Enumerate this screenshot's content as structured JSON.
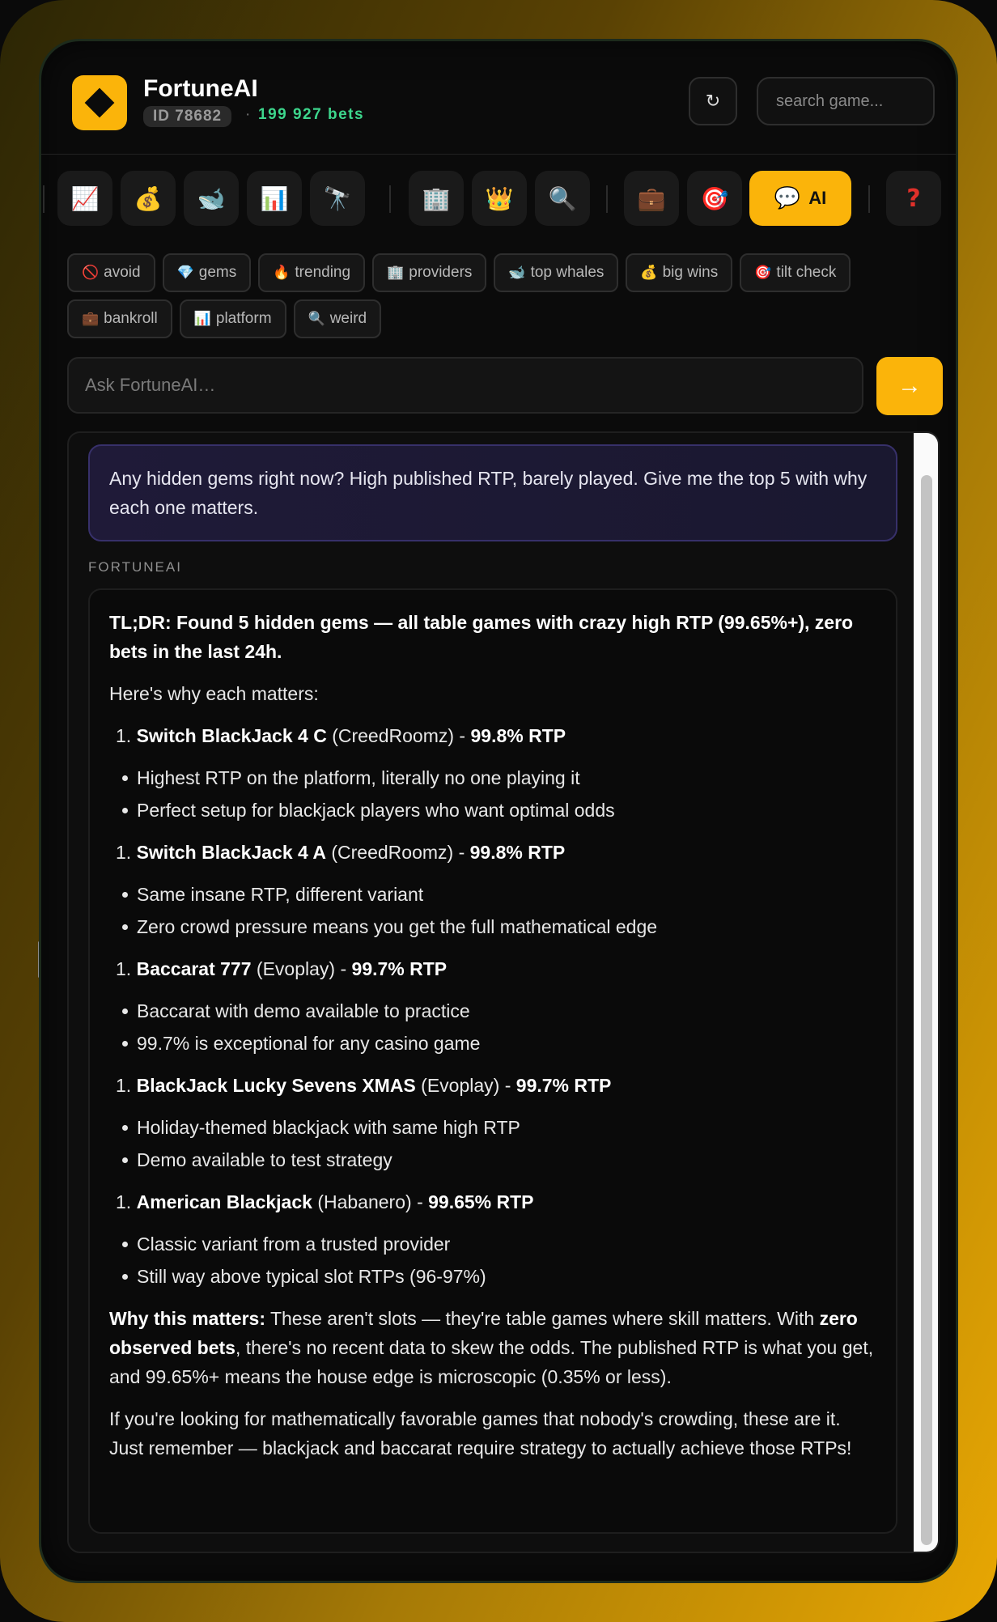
{
  "header": {
    "app_title": "FortuneAI",
    "id_badge": "ID 78682",
    "separator": "·",
    "bets": "199 927 bets",
    "refresh_icon": "↻",
    "search_placeholder": "search game..."
  },
  "toolbar": {
    "icons": [
      "chart-up-icon",
      "money-bag-icon",
      "whale-icon",
      "bar-chart-icon",
      "telescope-icon",
      "building-icon",
      "crown-icon",
      "magnifier-icon",
      "briefcase-icon",
      "target-icon"
    ],
    "glyphs": [
      "📈",
      "💰",
      "🐋",
      "📊",
      "🔭",
      "🏢",
      "👑",
      "🔍",
      "💼",
      "🎯"
    ],
    "ai_icon": "💬",
    "ai_label": "AI",
    "help_label": "?"
  },
  "chips": [
    {
      "icon": "🚫",
      "label": "avoid"
    },
    {
      "icon": "💎",
      "label": "gems"
    },
    {
      "icon": "🔥",
      "label": "trending"
    },
    {
      "icon": "🏢",
      "label": "providers"
    },
    {
      "icon": "🐋",
      "label": "top whales"
    },
    {
      "icon": "💰",
      "label": "big wins"
    },
    {
      "icon": "🎯",
      "label": "tilt check"
    },
    {
      "icon": "💼",
      "label": "bankroll"
    },
    {
      "icon": "📊",
      "label": "platform"
    },
    {
      "icon": "🔍",
      "label": "weird"
    }
  ],
  "ask": {
    "placeholder": "Ask FortuneAI…",
    "send_icon": "→"
  },
  "conversation": {
    "user_message": "Any hidden gems right now? High published RTP, barely played. Give me the top 5 with why each one matters.",
    "ai_label": "FORTUNEAI",
    "tldr": "TL;DR: Found 5 hidden gems — all table games with crazy high RTP (99.65%+), zero bets in the last 24h.",
    "intro": "Here's why each matters:",
    "games": [
      {
        "num": "1.",
        "name": "Switch BlackJack 4 C",
        "provider": "(CreedRoomz)",
        "dash": "-",
        "rtp": "99.8% RTP",
        "bullets": [
          "Highest RTP on the platform, literally no one playing it",
          "Perfect setup for blackjack players who want optimal odds"
        ]
      },
      {
        "num": "1.",
        "name": "Switch BlackJack 4 A",
        "provider": "(CreedRoomz)",
        "dash": "-",
        "rtp": "99.8% RTP",
        "bullets": [
          "Same insane RTP, different variant",
          "Zero crowd pressure means you get the full mathematical edge"
        ]
      },
      {
        "num": "1.",
        "name": "Baccarat 777",
        "provider": "(Evoplay)",
        "dash": "-",
        "rtp": "99.7% RTP",
        "bullets": [
          "Baccarat with demo available to practice",
          "99.7% is exceptional for any casino game"
        ]
      },
      {
        "num": "1.",
        "name": "BlackJack Lucky Sevens XMAS",
        "provider": "(Evoplay)",
        "dash": "-",
        "rtp": "99.7% RTP",
        "bullets": [
          "Holiday-themed blackjack with same high RTP",
          "Demo available to test strategy"
        ]
      },
      {
        "num": "1.",
        "name": "American Blackjack",
        "provider": "(Habanero)",
        "dash": "-",
        "rtp": "99.65% RTP",
        "bullets": [
          "Classic variant from a trusted provider",
          "Still way above typical slot RTPs (96-97%)"
        ]
      }
    ],
    "why_label": "Why this matters:",
    "why_text_1": " These aren't slots — they're table games where skill matters. With ",
    "why_bold": "zero observed bets",
    "why_text_2": ", there's no recent data to skew the odds. The published RTP is what you get, and 99.65%+ means the house edge is microscopic (0.35% or less).",
    "closing": "If you're looking for mathematically favorable games that nobody's crowding, these are it. Just remember — blackjack and baccarat require strategy to actually achieve those RTPs!"
  }
}
